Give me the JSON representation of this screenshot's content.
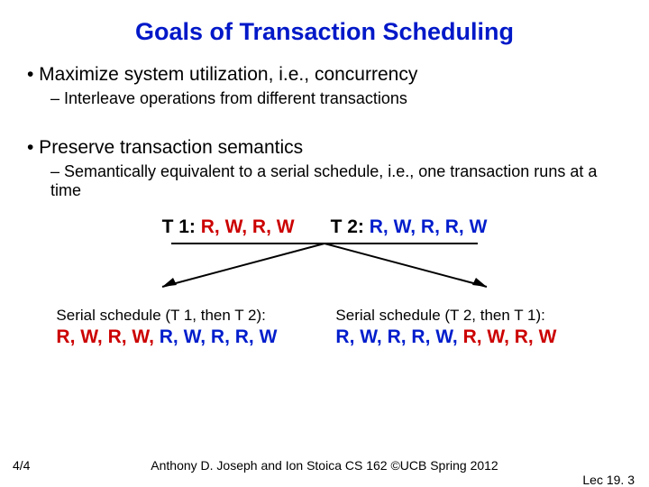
{
  "title": "Goals of Transaction Scheduling",
  "bullets": {
    "b1": "•  Maximize system utilization, i.e., concurrency",
    "b1a": "– Interleave operations from different transactions",
    "b2": "•  Preserve transaction semantics",
    "b2a": "– Semantically equivalent to a serial schedule, i.e., one transaction runs at a time"
  },
  "txn": {
    "t1_label": "T 1:",
    "t1_ops": " R, W, R, W",
    "t2_label": "T 2:",
    "t2_ops": " R, W, R, R, W"
  },
  "schedules": {
    "left_label": "Serial schedule (T 1, then T 2):",
    "left_red": "R, W, R, W, ",
    "left_blue": "R, W, R, R, W",
    "right_label": "Serial schedule (T 2, then T 1):",
    "right_blue": "R, W, R, R, W, ",
    "right_red": "R, W, R, W"
  },
  "footer": {
    "left": "4/4",
    "center": "Anthony D. Joseph and Ion Stoica CS 162 ©UCB Spring 2012",
    "right": "Lec 19. 3"
  },
  "colors": {
    "title": "#0018c8",
    "red": "#cc0000",
    "blue": "#001dcc"
  }
}
